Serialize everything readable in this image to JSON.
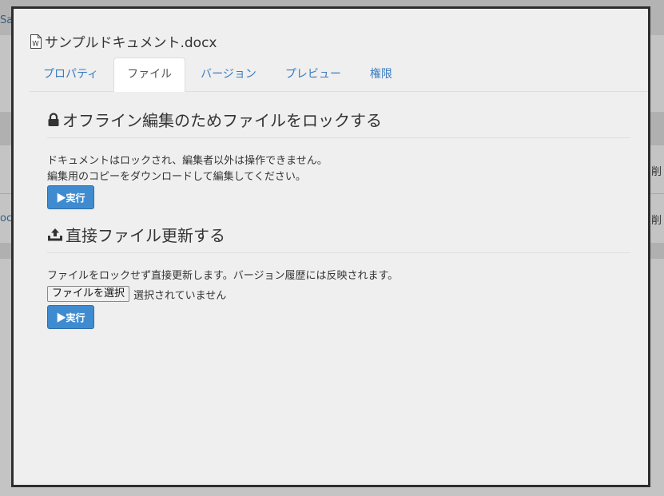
{
  "background": {
    "top_link_fragment": "San",
    "row_link_fragment": "oc",
    "right_fragment_1": "削",
    "right_fragment_2": "削"
  },
  "modal": {
    "title": "サンプルドキュメント.docx",
    "title_icon": "word-document-icon",
    "tabs": [
      {
        "label": "プロパティ",
        "active": false
      },
      {
        "label": "ファイル",
        "active": true
      },
      {
        "label": "バージョン",
        "active": false
      },
      {
        "label": "プレビュー",
        "active": false
      },
      {
        "label": "権限",
        "active": false
      }
    ],
    "lock_section": {
      "icon": "lock-icon",
      "heading": "オフライン編集のためファイルをロックする",
      "desc_line1": "ドキュメントはロックされ、編集者以外は操作できません。",
      "desc_line2": "編集用のコピーをダウンロードして編集してください。",
      "button_label": "▶実行"
    },
    "update_section": {
      "icon": "upload-icon",
      "heading": "直接ファイル更新する",
      "desc": "ファイルをロックせず直接更新します。バージョン履歴には反映されます。",
      "file_button_label": "ファイルを選択",
      "file_status": "選択されていません",
      "button_label": "▶実行"
    }
  },
  "colors": {
    "accent": "#3f8bd0",
    "tab_link": "#3a7bbf",
    "modal_bg": "#efefef",
    "modal_border": "#2e2e2e"
  }
}
